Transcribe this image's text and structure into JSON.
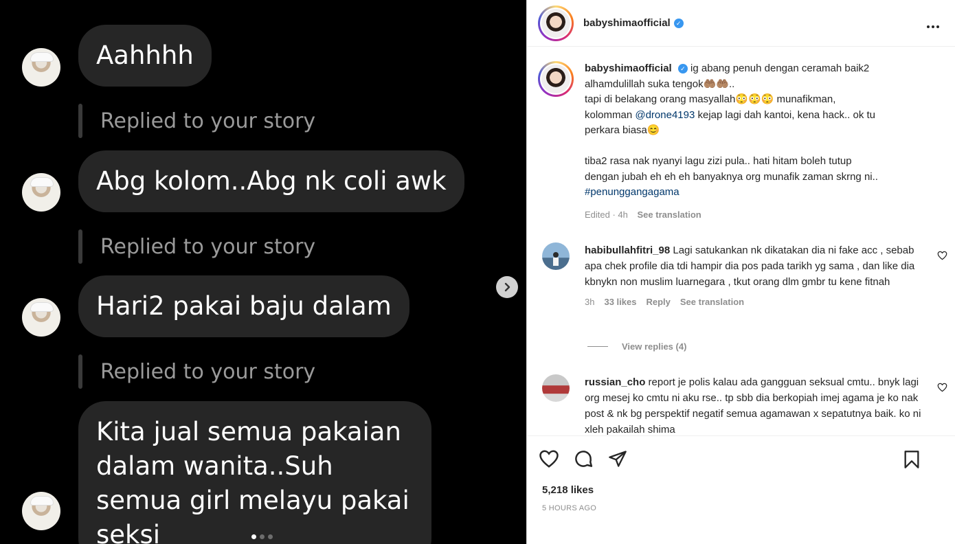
{
  "media": {
    "messages": [
      {
        "text": "Aahhhh"
      },
      {
        "reply_label": "Replied to your story",
        "text": "Abg kolom..Abg nk coli awk"
      },
      {
        "reply_label": "Replied to your story",
        "text": "Hari2 pakai baju dalam"
      },
      {
        "reply_label": "Replied to your story",
        "text": "Kita jual semua pakaian dalam wanita..Suh semua girl melayu pakai seksi"
      }
    ],
    "next_icon": "chevron-right-icon",
    "carousel": {
      "count": 3,
      "active": 1
    }
  },
  "post": {
    "username": "babyshimaofficial",
    "verified_icon": "verified-badge-icon",
    "more_icon": "more-options-icon",
    "caption": {
      "line1": "ig abang penuh dengan ceramah baik2",
      "line2": "alhamdulillah suka tengok🤲🏽🤲🏽..",
      "line3": "tapi di belakang orang masyallah😳😳😳 munafikman,",
      "line4_pre": "kolomman ",
      "mention": "@drone4193",
      "line4_post": " kejap lagi dah kantoi, kena hack.. ok tu",
      "line5": "perkara biasa😊",
      "line6": "tiba2 rasa nak nyanyi lagu zizi pula.. hati hitam boleh tutup",
      "line7": "dengan jubah eh eh eh banyaknya org munafik zaman skrng ni..",
      "hashtag": "#penunggangagama",
      "edited": "Edited · 4h",
      "see_translation": "See translation"
    },
    "comments": [
      {
        "username": "habibullahfitri_98",
        "text": "Lagi satukankan nk dikatakan dia ni fake acc , sebab apa chek profile dia tdi hampir dia pos pada tarikh yg sama , dan like dia kbnykn non muslim luarnegara , tkut orang dlm gmbr tu kene fitnah",
        "time": "3h",
        "likes": "33 likes",
        "reply": "Reply",
        "see_translation": "See translation",
        "view_replies": "View replies (4)"
      },
      {
        "username": "russian_cho",
        "text": "report je polis kalau ada gangguan seksual cmtu.. bnyk lagi org mesej ko cmtu ni aku rse.. tp sbb dia berkopiah imej agama je ko nak post & nk bg perspektif negatif semua agamawan x sepatutnya baik. ko ni xleh pakailah shima"
      }
    ],
    "likes": "5,218 likes",
    "time_ago": "5 HOURS AGO",
    "action_icons": [
      "heart-icon",
      "comment-icon",
      "share-icon",
      "bookmark-icon"
    ]
  }
}
